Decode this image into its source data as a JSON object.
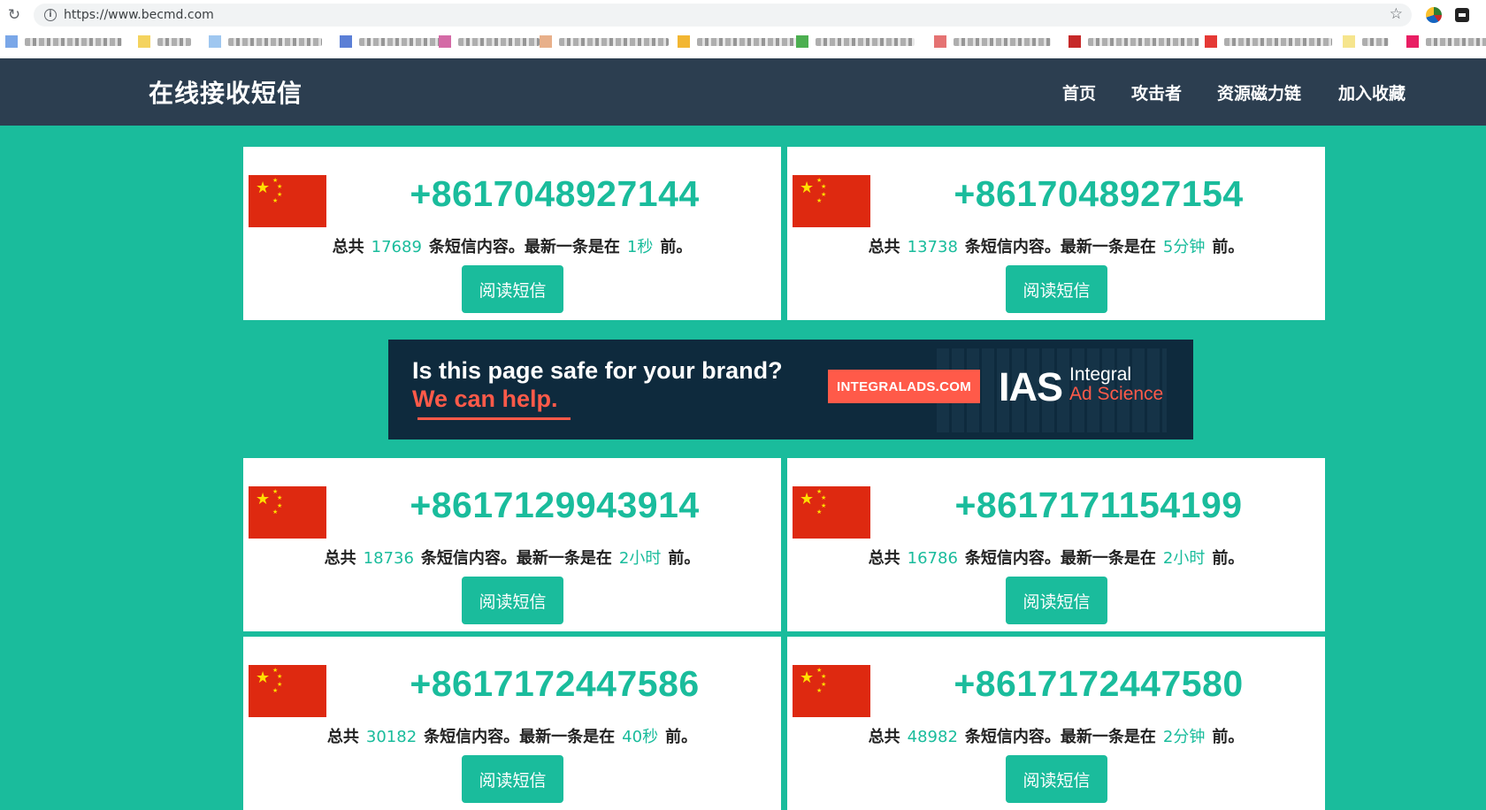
{
  "browser": {
    "url": "https://www.becmd.com",
    "reload_icon": "reload-icon",
    "info_icon": "info-icon",
    "star_icon": "star-icon"
  },
  "navbar": {
    "brand": "在线接收短信",
    "items": [
      "首页",
      "攻击者",
      "资源磁力链",
      "加入收藏"
    ]
  },
  "cards": [
    {
      "number": "+8617048927144",
      "total_prefix": "总共",
      "total": "17689",
      "mid": "条短信内容。最新一条是在",
      "ago": "1秒",
      "suffix": "前。",
      "button": "阅读短信"
    },
    {
      "number": "+8617048927154",
      "total_prefix": "总共",
      "total": "13738",
      "mid": "条短信内容。最新一条是在",
      "ago": "5分钟",
      "suffix": "前。",
      "button": "阅读短信"
    },
    {
      "number": "+8617129943914",
      "total_prefix": "总共",
      "total": "18736",
      "mid": "条短信内容。最新一条是在",
      "ago": "2小时",
      "suffix": "前。",
      "button": "阅读短信"
    },
    {
      "number": "+8617171154199",
      "total_prefix": "总共",
      "total": "16786",
      "mid": "条短信内容。最新一条是在",
      "ago": "2小时",
      "suffix": "前。",
      "button": "阅读短信"
    },
    {
      "number": "+8617172447586",
      "total_prefix": "总共",
      "total": "30182",
      "mid": "条短信内容。最新一条是在",
      "ago": "40秒",
      "suffix": "前。",
      "button": "阅读短信"
    },
    {
      "number": "+8617172447580",
      "total_prefix": "总共",
      "total": "48982",
      "mid": "条短信内容。最新一条是在",
      "ago": "2分钟",
      "suffix": "前。",
      "button": "阅读短信"
    }
  ],
  "ad": {
    "line1": "Is this page safe for your brand?",
    "line2": "We can help.",
    "button": "INTEGRALADS.COM",
    "logo": "IAS",
    "logo_text1": "Integral",
    "logo_text2": "Ad Science"
  },
  "colors": {
    "accent": "#1abc9c",
    "navbar": "#2c3e50",
    "flag_red": "#de2910",
    "flag_star": "#ffde00",
    "ad_bg": "#0e2a3d",
    "ad_accent": "#ff5a49"
  }
}
